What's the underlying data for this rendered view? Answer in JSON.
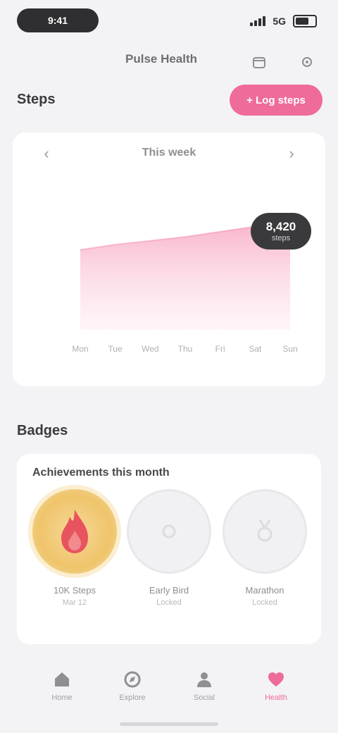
{
  "status_bar": {
    "time": "9:41",
    "network": "5G",
    "signal_bars": 4
  },
  "header": {
    "brand": "Pulse Health",
    "icons": [
      "calendar-icon",
      "settings-icon"
    ]
  },
  "steps_section": {
    "title": "Steps",
    "cta_label": "+ Log steps"
  },
  "chart_card": {
    "period_label": "This week",
    "prev_icon": "chevron-left-icon",
    "next_icon": "chevron-right-icon",
    "tooltip": {
      "value": "8,420",
      "unit": "steps"
    }
  },
  "chart_data": {
    "type": "area",
    "categories": [
      "Mon",
      "Tue",
      "Wed",
      "Thu",
      "Fri",
      "Sat",
      "Sun"
    ],
    "values": [
      6200,
      6600,
      6900,
      7200,
      7600,
      8000,
      8420
    ],
    "ylim": [
      0,
      12000
    ],
    "grid": false,
    "color": "#ee6b9a"
  },
  "badges_section": {
    "title": "Badges",
    "card_title": "Achievements this month",
    "badges": [
      {
        "name": "10K Steps",
        "date": "Mar 12",
        "earned": true,
        "icon": "flame-icon"
      },
      {
        "name": "Early Bird",
        "date": "Locked",
        "earned": false,
        "icon": "sun-icon"
      },
      {
        "name": "Marathon",
        "date": "Locked",
        "earned": false,
        "icon": "medal-icon"
      }
    ]
  },
  "tab_bar": {
    "items": [
      {
        "label": "Home",
        "icon": "home-icon",
        "active": false
      },
      {
        "label": "Explore",
        "icon": "compass-icon",
        "active": false
      },
      {
        "label": "Social",
        "icon": "people-icon",
        "active": false
      },
      {
        "label": "Health",
        "icon": "heart-icon",
        "active": true
      }
    ]
  },
  "colors": {
    "accent": "#ee6b9a",
    "dark": "#2f2f31",
    "badge_gold": "#efc46a"
  }
}
